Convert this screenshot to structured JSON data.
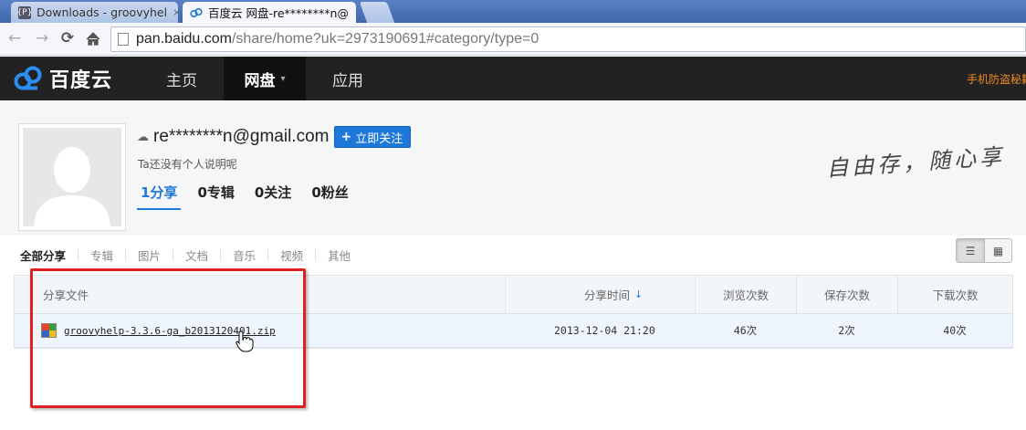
{
  "browser": {
    "tabs": [
      {
        "label": "Downloads - groovyhel",
        "close": "×"
      },
      {
        "label": "百度云 网盘-re********n@",
        "close": "×"
      }
    ],
    "url_host": "pan.baidu.com",
    "url_path": "/share/home?uk=2973190691#category/type=0",
    "icons": {
      "back": "arrow-left-icon",
      "forward": "arrow-right-icon",
      "reload": "reload-icon",
      "home": "home-icon"
    }
  },
  "site": {
    "logo_text": "百度云",
    "nav": [
      {
        "label": "主页"
      },
      {
        "label": "网盘"
      },
      {
        "label": "应用"
      }
    ],
    "promo": "手机防盗秘籍",
    "accent": "#1e78d8"
  },
  "profile": {
    "username": "re********n@gmail.com",
    "follow_label": "立即关注",
    "bio": "Ta还没有个人说明呢",
    "stats": [
      {
        "label": "1分享"
      },
      {
        "label": "0专辑"
      },
      {
        "label": "0关注"
      },
      {
        "label": "0粉丝"
      }
    ],
    "slogan": "自由存，随心享"
  },
  "categories": [
    {
      "label": "全部分享"
    },
    {
      "label": "专辑"
    },
    {
      "label": "图片"
    },
    {
      "label": "文档"
    },
    {
      "label": "音乐"
    },
    {
      "label": "视频"
    },
    {
      "label": "其他"
    }
  ],
  "table": {
    "columns": [
      "分享文件",
      "分享时间",
      "浏览次数",
      "保存次数",
      "下载次数"
    ],
    "sort_icon": "arrow-down-icon",
    "rows": [
      {
        "file": "groovyhelp-3.3.6-ga_b2013120401.zip",
        "time": "2013-12-04 21:20",
        "views": "46次",
        "saves": "2次",
        "downloads": "40次"
      }
    ]
  }
}
